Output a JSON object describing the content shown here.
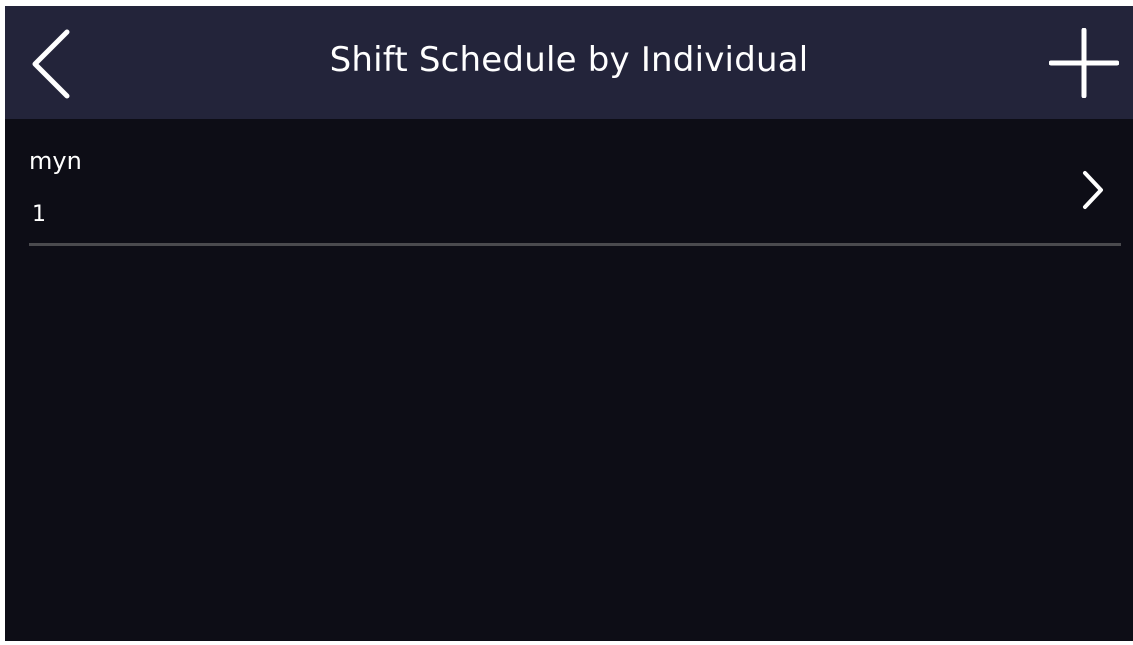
{
  "header": {
    "title": "Shift Schedule by Individual",
    "back_icon": "chevron-left-icon",
    "add_icon": "plus-icon"
  },
  "list": {
    "items": [
      {
        "name": "myn",
        "value": "1",
        "chevron_icon": "chevron-right-icon"
      }
    ]
  },
  "colors": {
    "header_bg": "#23243a",
    "screen_bg": "#0d0d16",
    "text": "#ffffff",
    "divider": "#4a4a4e"
  }
}
